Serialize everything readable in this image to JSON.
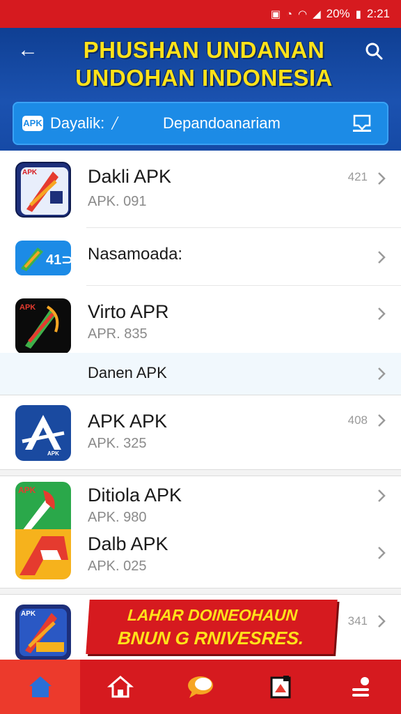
{
  "status_bar": {
    "battery": "20%",
    "time": "2:21"
  },
  "header": {
    "title_line1": "PHUSHAN UNDANAN",
    "title_line2": "UNDOHAN INDONESIA",
    "tab_left": "Dayalik:",
    "tab_left_badge": "APK",
    "tab_right": "Depandoanariam"
  },
  "apps": [
    {
      "name": "Dakli APK",
      "sub": "APK. 091",
      "meta": "421",
      "icon_label": "APK"
    },
    {
      "name": "Nasamoada:",
      "sub": "",
      "meta": ""
    },
    {
      "name": "Virto APR",
      "sub": "APR. 835",
      "meta": "",
      "icon_label": "APK"
    },
    {
      "name": "Danen APK",
      "sub": "",
      "meta": ""
    },
    {
      "name": "APK APK",
      "sub": "APK. 325",
      "meta": "408",
      "icon_label": "APK"
    },
    {
      "name": "Ditiola APK",
      "sub": "APK. 980",
      "meta": "",
      "icon_label": "APK"
    },
    {
      "name": "Dalb APK",
      "sub": "APK. 025",
      "meta": ""
    },
    {
      "name": "",
      "sub": "",
      "meta": "341",
      "icon_label": "APK"
    }
  ],
  "banner": {
    "line1": "LAHAR DOINEOHAUN",
    "line2": "BNUN G RNIVESRES."
  },
  "nav": [
    {
      "label": "home-active"
    },
    {
      "label": "home"
    },
    {
      "label": "chat"
    },
    {
      "label": "box"
    },
    {
      "label": "profile"
    }
  ],
  "colors": {
    "brand_red": "#d61a1f",
    "header_blue": "#1b52b0",
    "title_yellow": "#ffe21a",
    "tab_blue": "#1c8be6"
  },
  "icons": [
    "back-arrow-icon",
    "search-icon",
    "apk-icon",
    "mailbox-icon",
    "chevron-right-icon",
    "home-icon",
    "chat-icon",
    "box-icon",
    "profile-icon"
  ]
}
